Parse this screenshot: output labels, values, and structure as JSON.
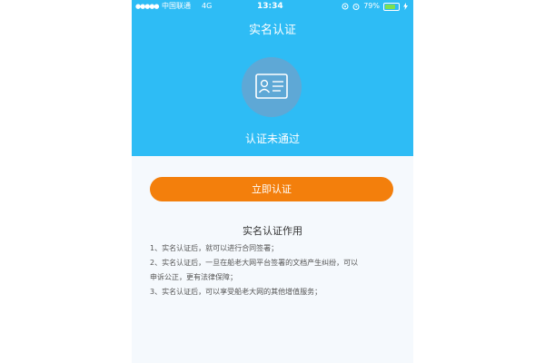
{
  "status_bar": {
    "signal": "●●●●●",
    "carrier": "中国联通",
    "network": "4G",
    "time": "13:34",
    "battery_percent": "79%",
    "battery_level": 0.79
  },
  "header": {
    "title": "实名认证",
    "status": "认证未通过"
  },
  "actions": {
    "verify_button": "立即认证"
  },
  "info": {
    "heading": "实名认证作用",
    "items": [
      "1、实名认证后，就可以进行合同签署；",
      "2、实名认证后，一旦在船老大网平台签署的文档产生纠纷，可以",
      "申诉公正，更有法律保障；",
      "3、实名认证后，可以享受船老大网的其他增值服务；"
    ]
  },
  "colors": {
    "header_bg": "#2ebcf5",
    "button_bg": "#f37f0c",
    "page_bg": "#f5f9fd"
  },
  "icons": [
    "id-card-icon",
    "location-icon",
    "alarm-icon",
    "battery-icon",
    "charging-icon"
  ]
}
